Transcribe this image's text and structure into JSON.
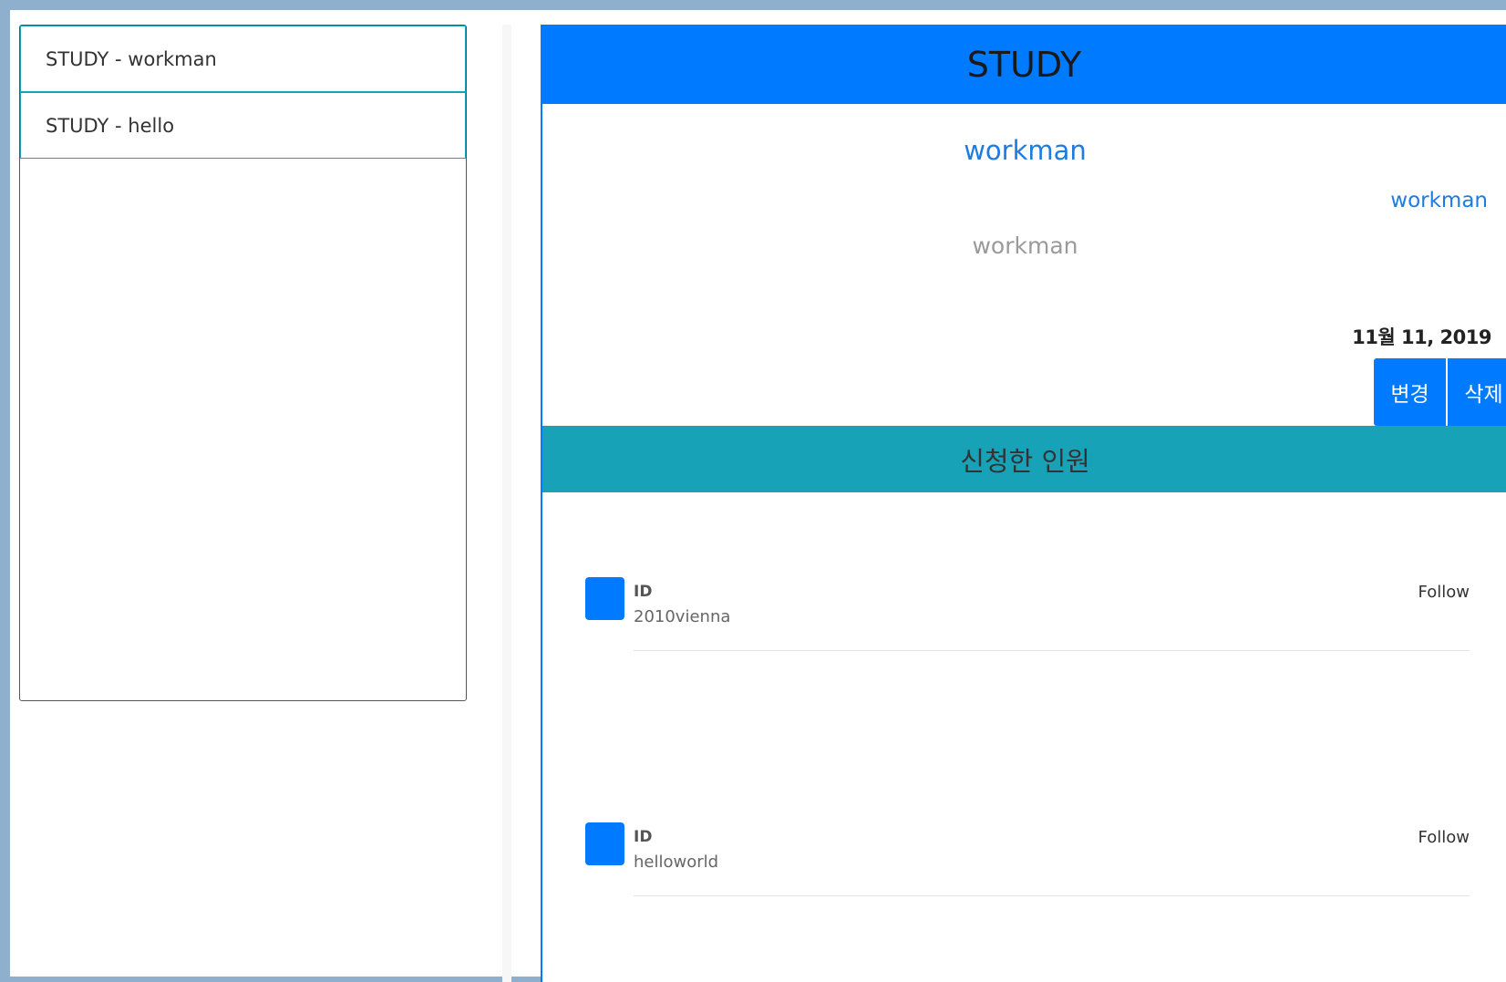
{
  "sidebar": {
    "items": [
      {
        "label": "STUDY - workman"
      },
      {
        "label": "STUDY - hello"
      }
    ]
  },
  "card": {
    "header": "STUDY",
    "title": "workman",
    "author": "workman",
    "description": "workman",
    "date": "11월 11, 2019",
    "edit_label": "변경",
    "delete_label": "삭제",
    "applicants_label": "신청한 인원"
  },
  "members": [
    {
      "label": "ID",
      "id": "2010vienna",
      "follow": "Follow"
    },
    {
      "label": "ID",
      "id": "helloworld",
      "follow": "Follow"
    }
  ],
  "colors": {
    "primary": "#007bff",
    "info": "#17a2b8",
    "frame": "#8fafcf"
  }
}
